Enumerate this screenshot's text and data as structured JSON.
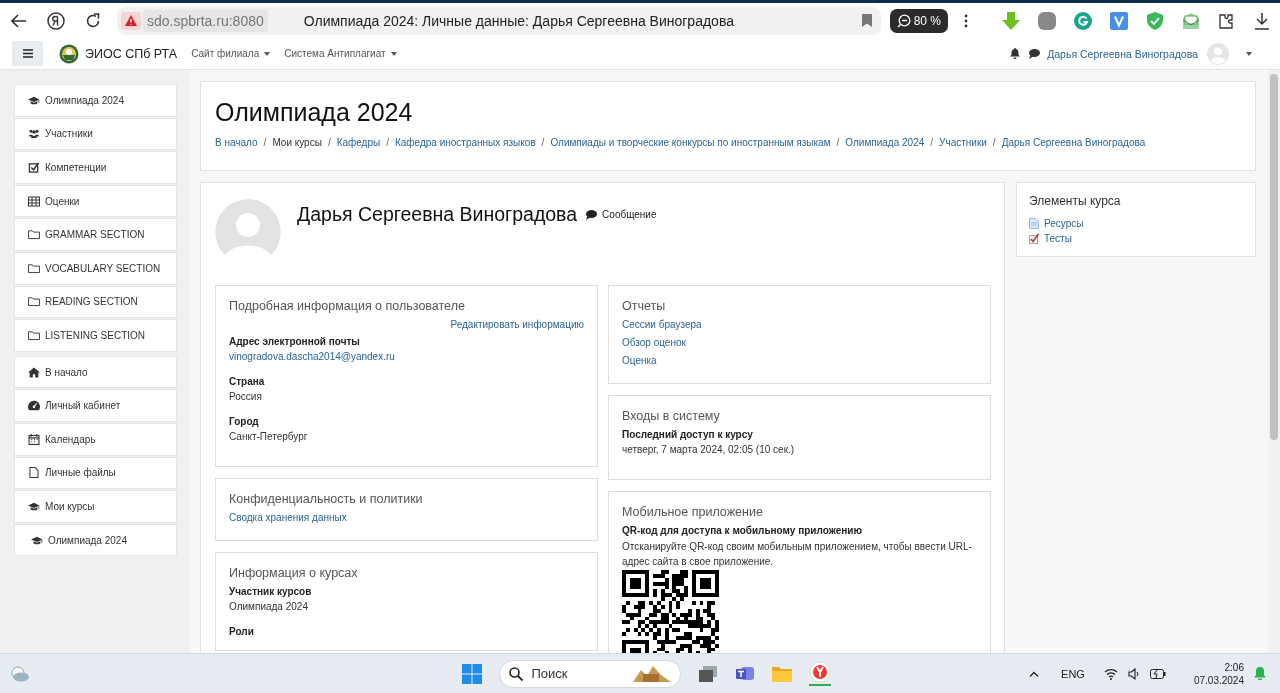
{
  "browser": {
    "url": "sdo.spbrta.ru:8080",
    "title": "Олимпиада 2024: Личные данные: Дарья Сергеевна Виноградова",
    "zoom": "80 %"
  },
  "navbar": {
    "brand": "ЭИОС СПб РТА",
    "menus": [
      "Сайт филиала",
      "Система Антиплагиат"
    ],
    "user": "Дарья Сергеевна Виноградова"
  },
  "sidebar": {
    "groups": [
      [
        {
          "kind": "course",
          "label": "Олимпиада 2024"
        },
        {
          "kind": "participants",
          "label": "Участники"
        },
        {
          "kind": "competencies",
          "label": "Компетенции"
        },
        {
          "kind": "grades",
          "label": "Оценки"
        },
        {
          "kind": "section",
          "label": "GRAMMAR SECTION"
        },
        {
          "kind": "section",
          "label": "VOCABULARY SECTION"
        },
        {
          "kind": "section",
          "label": "READING SECTION"
        },
        {
          "kind": "section",
          "label": "LISTENING SECTION"
        }
      ],
      [
        {
          "kind": "home",
          "label": "В начало"
        },
        {
          "kind": "dashboard",
          "label": "Личный кабинет"
        },
        {
          "kind": "calendar",
          "label": "Календарь"
        },
        {
          "kind": "files",
          "label": "Личные файлы"
        },
        {
          "kind": "course",
          "label": "Мои курсы",
          "children": [
            {
              "kind": "course",
              "label": "Олимпиада 2024"
            }
          ]
        }
      ]
    ]
  },
  "header": {
    "title": "Олимпиада 2024",
    "separator": "/",
    "breadcrumb": [
      {
        "text": "В начало",
        "link": true
      },
      {
        "text": "Мои курсы",
        "link": false
      },
      {
        "text": "Кафедры",
        "link": true
      },
      {
        "text": "Кафедра иностранных языков",
        "link": true
      },
      {
        "text": "Олимпиады и творческие конкурсы по иностранным языкам",
        "link": true
      },
      {
        "text": "Олимпиада 2024",
        "link": true
      },
      {
        "text": "Участники",
        "link": true
      },
      {
        "text": "Дарья Сергеевна Виноградова",
        "link": true
      }
    ]
  },
  "profile": {
    "name": "Дарья Сергеевна Виноградова",
    "message": "Сообщение",
    "left_sections": [
      {
        "title": "Подробная информация о пользователе",
        "action": "Редактировать информацию",
        "items": [
          {
            "kind": "field",
            "label": "Адрес электронной почты",
            "value": "vinogradova.dascha2014@yandex.ru",
            "link": true
          },
          {
            "kind": "field",
            "label": "Страна",
            "value": "Россия",
            "link": false
          },
          {
            "kind": "field",
            "label": "Город",
            "value": "Санкт-Петербург",
            "link": false
          }
        ]
      },
      {
        "title": "Конфиденциальность и политики",
        "items": [
          {
            "kind": "link",
            "text": "Сводка хранения данных"
          }
        ]
      },
      {
        "title": "Информация о курсах",
        "items": [
          {
            "kind": "field",
            "label": "Участник курсов",
            "value": "Олимпиада 2024",
            "link": false
          },
          {
            "kind": "label",
            "text": "Роли"
          }
        ]
      }
    ],
    "right_sections": [
      {
        "title": "Отчеты",
        "items": [
          {
            "kind": "link",
            "text": "Сессии браузера"
          },
          {
            "kind": "link",
            "text": "Обзор оценок"
          },
          {
            "kind": "link",
            "text": "Оценка"
          }
        ]
      },
      {
        "title": "Входы в систему",
        "items": [
          {
            "kind": "field",
            "label": "Последний доступ к курсу",
            "value": "четверг, 7 марта 2024, 02:05  (10 сек.)",
            "link": false
          }
        ]
      },
      {
        "title": "Мобильное приложение",
        "items": [
          {
            "kind": "label",
            "text": "QR-код для доступа к мобильному приложению"
          },
          {
            "kind": "text",
            "text": "Отсканируйте QR-код своим мобильным приложением, чтобы ввести URL-адрес сайта в свое приложение."
          },
          {
            "kind": "qr"
          }
        ]
      }
    ]
  },
  "course_elements": {
    "title": "Элементы курса",
    "items": [
      {
        "kind": "resource",
        "label": "Ресурсы"
      },
      {
        "kind": "quiz",
        "label": "Тесты"
      }
    ]
  },
  "taskbar": {
    "search": {
      "placeholder": "Поиск"
    },
    "language": "ENG",
    "time": "2:06",
    "date": "07.03.2024"
  }
}
